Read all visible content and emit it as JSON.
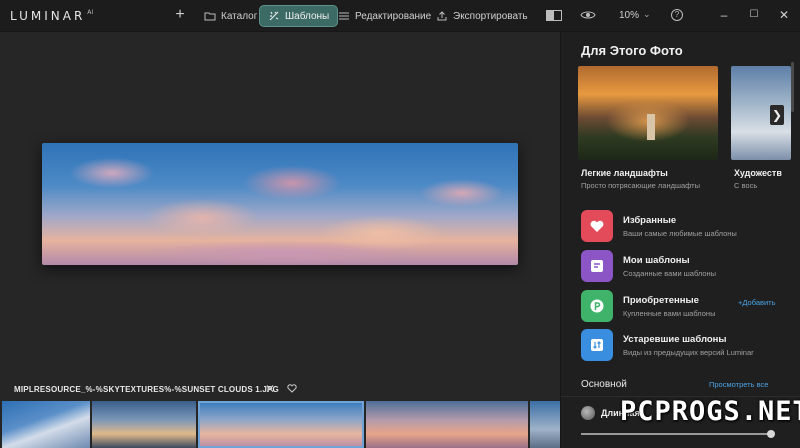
{
  "app": {
    "logo": "LUMINAR",
    "logo_sup": "AI"
  },
  "toolbar": {
    "plus": "+",
    "tabs": [
      {
        "label": "Каталог",
        "icon": "folder-icon"
      },
      {
        "label": "Шаблоны",
        "icon": "templates-icon",
        "active": true
      },
      {
        "label": "Редактирование",
        "icon": "sliders-icon"
      },
      {
        "label": "Экспортировать",
        "icon": "export-icon"
      }
    ],
    "zoom": "10%",
    "help": "?",
    "window": {
      "minimize": "–",
      "maximize": "☐",
      "close": "✕"
    }
  },
  "workspace": {
    "filename": "MIPLRESOURCE_%-%SKYTEXTURES%-%SUNSET CLOUDS 1.JPG",
    "close": "✕"
  },
  "panel": {
    "title": "Для Этого Фото",
    "cards": [
      {
        "title": "Легкие ландшафты",
        "subtitle": "Просто потрясающие ландшафты"
      },
      {
        "title": "Художеств",
        "subtitle": "С вось"
      }
    ],
    "next": "❯",
    "collections": [
      {
        "name": "Избранные",
        "desc": "Ваши самые любимые шаблоны",
        "icon": "heart-icon"
      },
      {
        "name": "Мои шаблоны",
        "desc": "Созданные вами шаблоны",
        "icon": "document-icon"
      },
      {
        "name": "Приобретенные",
        "desc": "Купленные вами шаблоны",
        "icon": "purchased-icon",
        "action": "+Добавить"
      },
      {
        "name": "Устаревшие шаблоны",
        "desc": "Виды из предыдущих версий Luminar",
        "icon": "legacy-icon"
      }
    ],
    "section": {
      "title": "Основной",
      "link": "Просмотреть все"
    },
    "row": {
      "name": "Длинная"
    },
    "slider": {
      "value": 0.98
    }
  },
  "watermark": "PCPROGS.NET",
  "colors": {
    "accent": "#3c6b66",
    "link": "#4aa3e6",
    "favorite": "#e34b5a",
    "mine": "#8c55c6",
    "purchased": "#3fb36a",
    "legacy": "#3a8ee0"
  }
}
